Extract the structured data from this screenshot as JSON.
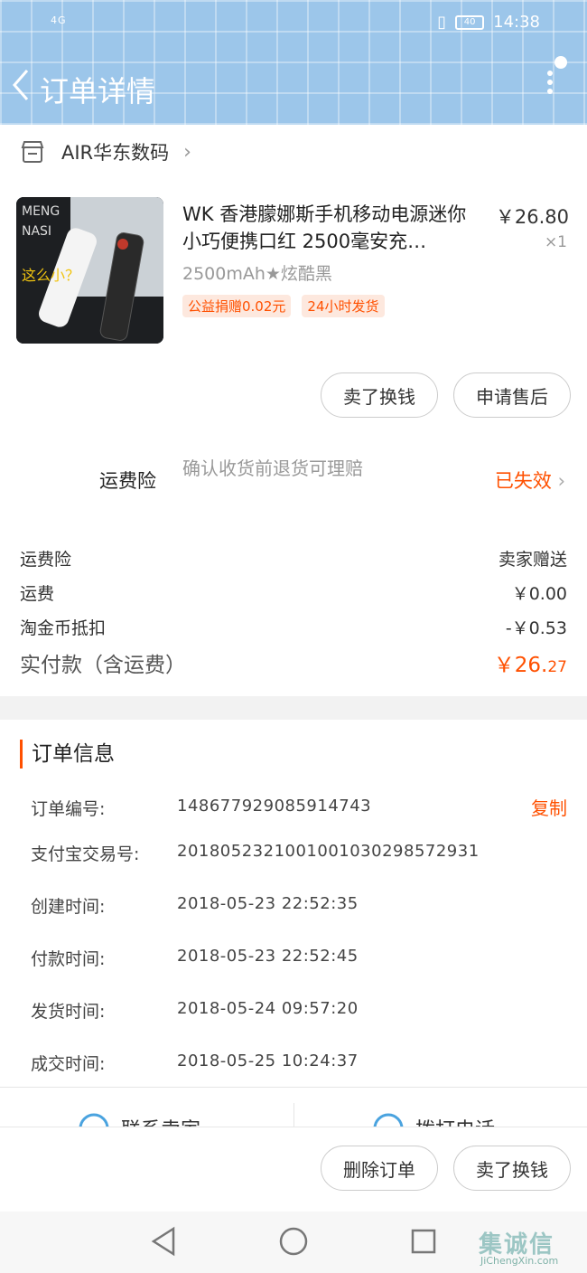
{
  "status_bar": {
    "signal": "4G",
    "battery": "40",
    "time": "14:38"
  },
  "nav": {
    "title": "订单详情"
  },
  "shop": {
    "name": "AIR华东数码"
  },
  "product": {
    "image_text_1": "MENG",
    "image_text_2": "NASI",
    "image_text_3": "这么小？",
    "title": "WK 香港朦娜斯手机移动电源迷你小巧便携口红 2500毫安充…",
    "price": "￥26.80",
    "qty": "×1",
    "sku": "2500mAh★炫酷黑",
    "tags": [
      "公益捐赠0.02元",
      "24小时发货"
    ]
  },
  "product_actions": {
    "sell": "卖了换钱",
    "after_sale": "申请售后"
  },
  "insurance": {
    "label": "运费险",
    "desc": "确认收货前退货可理赔",
    "status": "已失效"
  },
  "fees": [
    {
      "label": "运费险",
      "value": "卖家赠送"
    },
    {
      "label": "运费",
      "value": "￥0.00"
    },
    {
      "label": "淘金币抵扣",
      "value": "-￥0.53"
    }
  ],
  "total": {
    "label": "实付款（含运费）",
    "value_main": "￥26.",
    "value_dec": "27"
  },
  "order_info": {
    "title": "订单信息",
    "copy": "复制",
    "rows": [
      {
        "label": "订单编号:",
        "value": "148677929085914743"
      },
      {
        "label": "支付宝交易号:",
        "value": "2018052321001001030298572931"
      },
      {
        "label": "创建时间:",
        "value": "2018-05-23 22:52:35"
      },
      {
        "label": "付款时间:",
        "value": "2018-05-23 22:52:45"
      },
      {
        "label": "发货时间:",
        "value": "2018-05-24 09:57:20"
      },
      {
        "label": "成交时间:",
        "value": "2018-05-25 10:24:37"
      }
    ]
  },
  "contact": {
    "seller": "联系卖家",
    "call": "拨打电话"
  },
  "bottom_actions": {
    "delete": "删除订单",
    "sell": "卖了换钱"
  },
  "watermark": {
    "cn": "集诚信",
    "en": "JiChengXin.com"
  },
  "colors": {
    "accent": "#ff5000",
    "header_bg": "#9cc6ea"
  }
}
